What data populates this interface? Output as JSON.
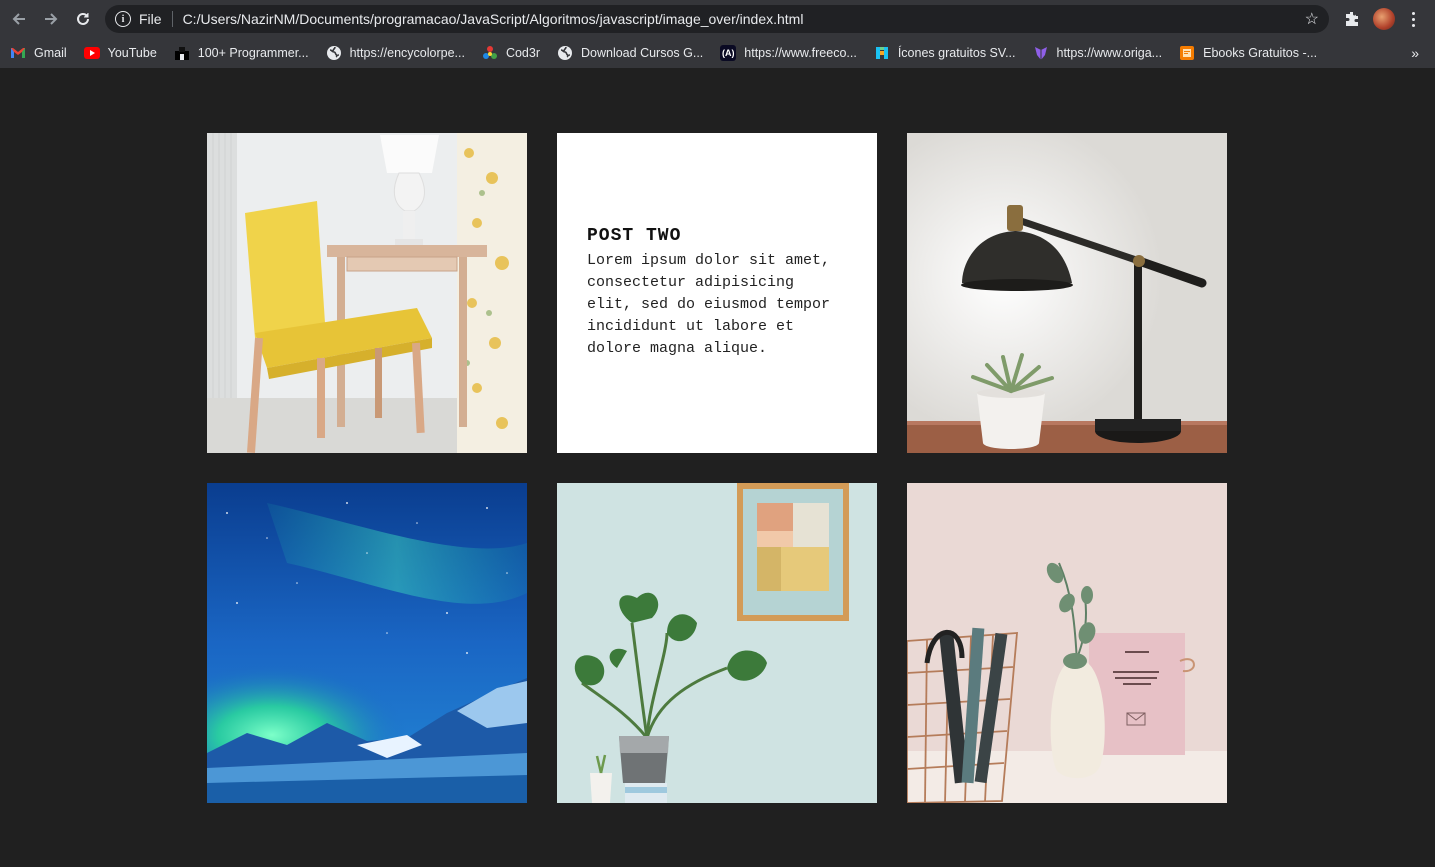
{
  "browser": {
    "address": {
      "scheme_label": "File",
      "url": "C:/Users/NazirNM/Documents/programacao/JavaScript/Algoritmos/javascript/image_over/index.html"
    },
    "bookmarks": [
      {
        "label": "Gmail",
        "icon": "gmail-icon",
        "color": "#ea4335"
      },
      {
        "label": "YouTube",
        "icon": "youtube-icon",
        "color": "#ff0000"
      },
      {
        "label": "100+ Programmer...",
        "icon": "bookmark-icon",
        "color": "#000000"
      },
      {
        "label": "https://encycolorpe...",
        "icon": "globe-icon",
        "color": "#e8eaed"
      },
      {
        "label": "Cod3r",
        "icon": "cod3r-icon",
        "color": "#4caf50"
      },
      {
        "label": "Download Cursos G...",
        "icon": "globe-icon",
        "color": "#e8eaed"
      },
      {
        "label": "https://www.freeco...",
        "icon": "freecodecamp-icon",
        "color": "#0a0a23"
      },
      {
        "label": "Ícones gratuitos SV...",
        "icon": "flaticon-icon",
        "color": "#1bc2f2"
      },
      {
        "label": "https://www.origa...",
        "icon": "origamid-icon",
        "color": "#8f5fe8"
      },
      {
        "label": "Ebooks Gratuitos -...",
        "icon": "ebook-icon",
        "color": "#f57c00"
      }
    ]
  },
  "gallery": {
    "post": {
      "title": "POST TWO",
      "body": "Lorem ipsum dolor sit amet, consectetur adipisicing elit, sed do eiusmod tempor incididunt ut labore et dolore magna alique."
    },
    "images": [
      {
        "subject": "yellow chair at desk",
        "icon": "chair-photo"
      },
      {
        "subject": "black desk lamp with plant",
        "icon": "lamp-photo"
      },
      {
        "subject": "aurora over mountains",
        "icon": "aurora-photo"
      },
      {
        "subject": "potted plant with framed art",
        "icon": "plant-photo"
      },
      {
        "subject": "vase, books and notebook",
        "icon": "vase-photo"
      }
    ]
  }
}
